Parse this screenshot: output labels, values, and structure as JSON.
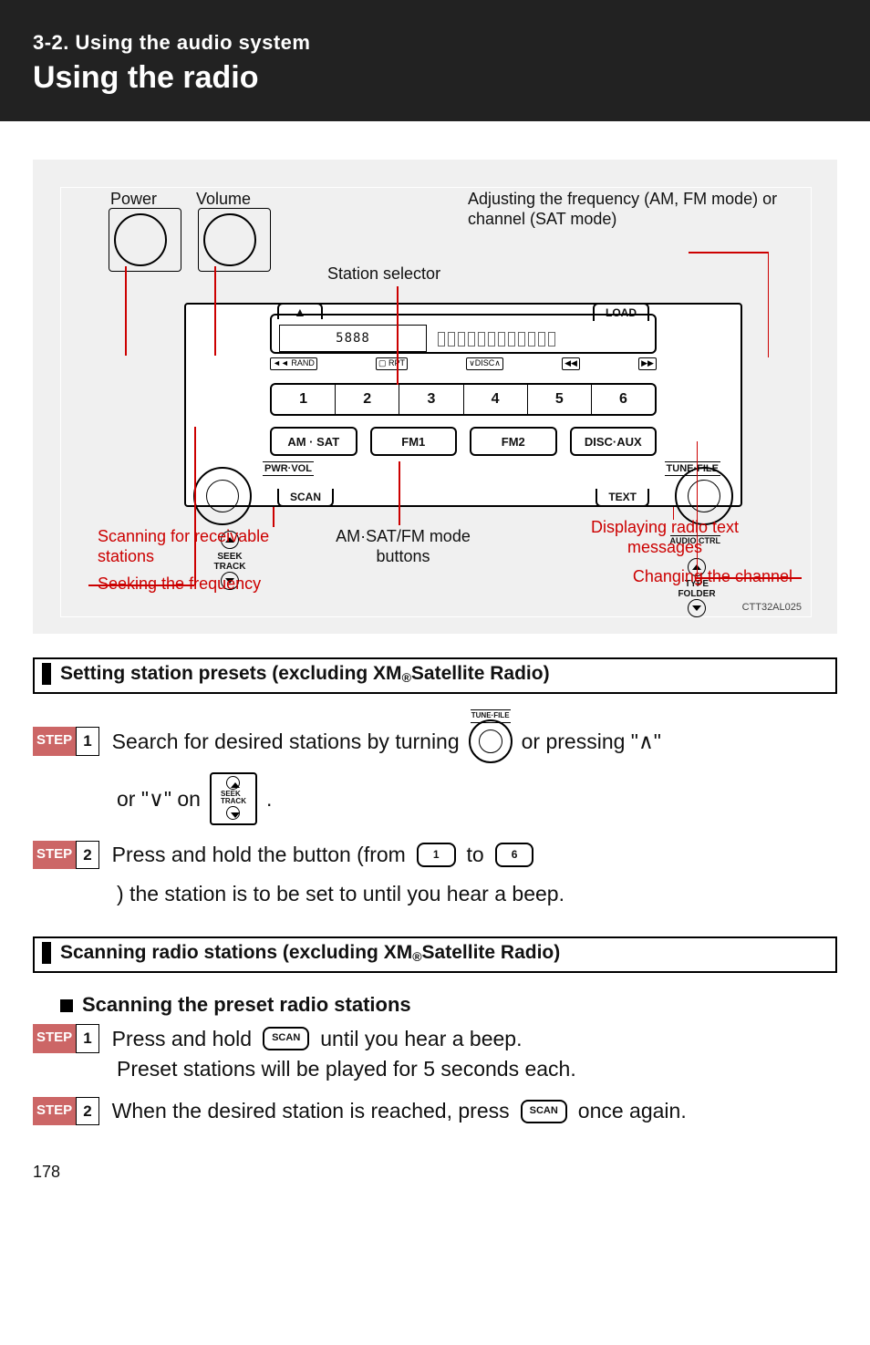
{
  "header": {
    "section": "3-2. Using the audio system",
    "title": "Using the radio"
  },
  "diagram": {
    "top_labels": {
      "power": "Power",
      "volume": "Volume"
    },
    "right_desc": "Adjusting   the   frequency (AM, FM mode) or channel (SAT mode)",
    "station_selector": "Station selector",
    "radio": {
      "eject": "▲",
      "load": "LOAD",
      "pwr_vol": "PWR·VOL",
      "tune_file": "TUNE·FILE",
      "audio_ctrl": "AUDIO CTRL",
      "display_text": "5888",
      "sub_left": "◄◄ RAND",
      "sub_mid1": "▢ RPT",
      "sub_mid2": "∨DISC∧",
      "sub_r1": "◀◀",
      "sub_r2": "▶▶",
      "presets": [
        "1",
        "2",
        "3",
        "4",
        "5",
        "6"
      ],
      "seek": "SEEK\nTRACK",
      "type": "TYPE\nFOLDER",
      "modes": [
        "AM · SAT",
        "FM1",
        "FM2",
        "DISC·AUX"
      ],
      "scan": "SCAN",
      "text": "TEXT"
    },
    "callouts": {
      "scan": "Scanning for receivable stations",
      "seek": "Seeking the frequency",
      "modes": "AM·SAT/FM mode buttons",
      "display": "Displaying radio text messages",
      "channel": "Changing the channel"
    },
    "imgcode": "CTT32AL025"
  },
  "section1_title_a": "Setting station presets (excluding XM",
  "section1_title_b": " Satellite Radio)",
  "reg": "®",
  "step_word": "STEP",
  "num1": "1",
  "num2": "2",
  "s1_step1_a": "Search for desired stations by turning ",
  "s1_step1_b": " or pressing \"∧\"",
  "s1_step1_c": "or \"∨\" on ",
  "tune_caption": "TUNE·FILE",
  "s1_step2_a": "Press and hold the button (from ",
  "s1_step2_b": " to ",
  "s1_step2_c": " ) the station is to be set to until you hear a beep.",
  "btn1": "1",
  "btn6": "6",
  "section2_title_a": "Scanning radio stations (excluding XM",
  "section2_title_b": " Satellite Radio)",
  "sub_h": "Scanning the preset radio stations",
  "s2_step1_a": "Press and hold ",
  "s2_step1_b": " until you hear a beep.",
  "s2_step1_c": "Preset stations will be played for 5 seconds each.",
  "s2_step2_a": "When  the  desired  station  is  reached,  press ",
  "s2_step2_b": " once again.",
  "scan_btn": "SCAN",
  "seek_box": {
    "up": "∧",
    "label": "SEEK\nTRACK",
    "dn": "∨"
  },
  "page_num": "178"
}
